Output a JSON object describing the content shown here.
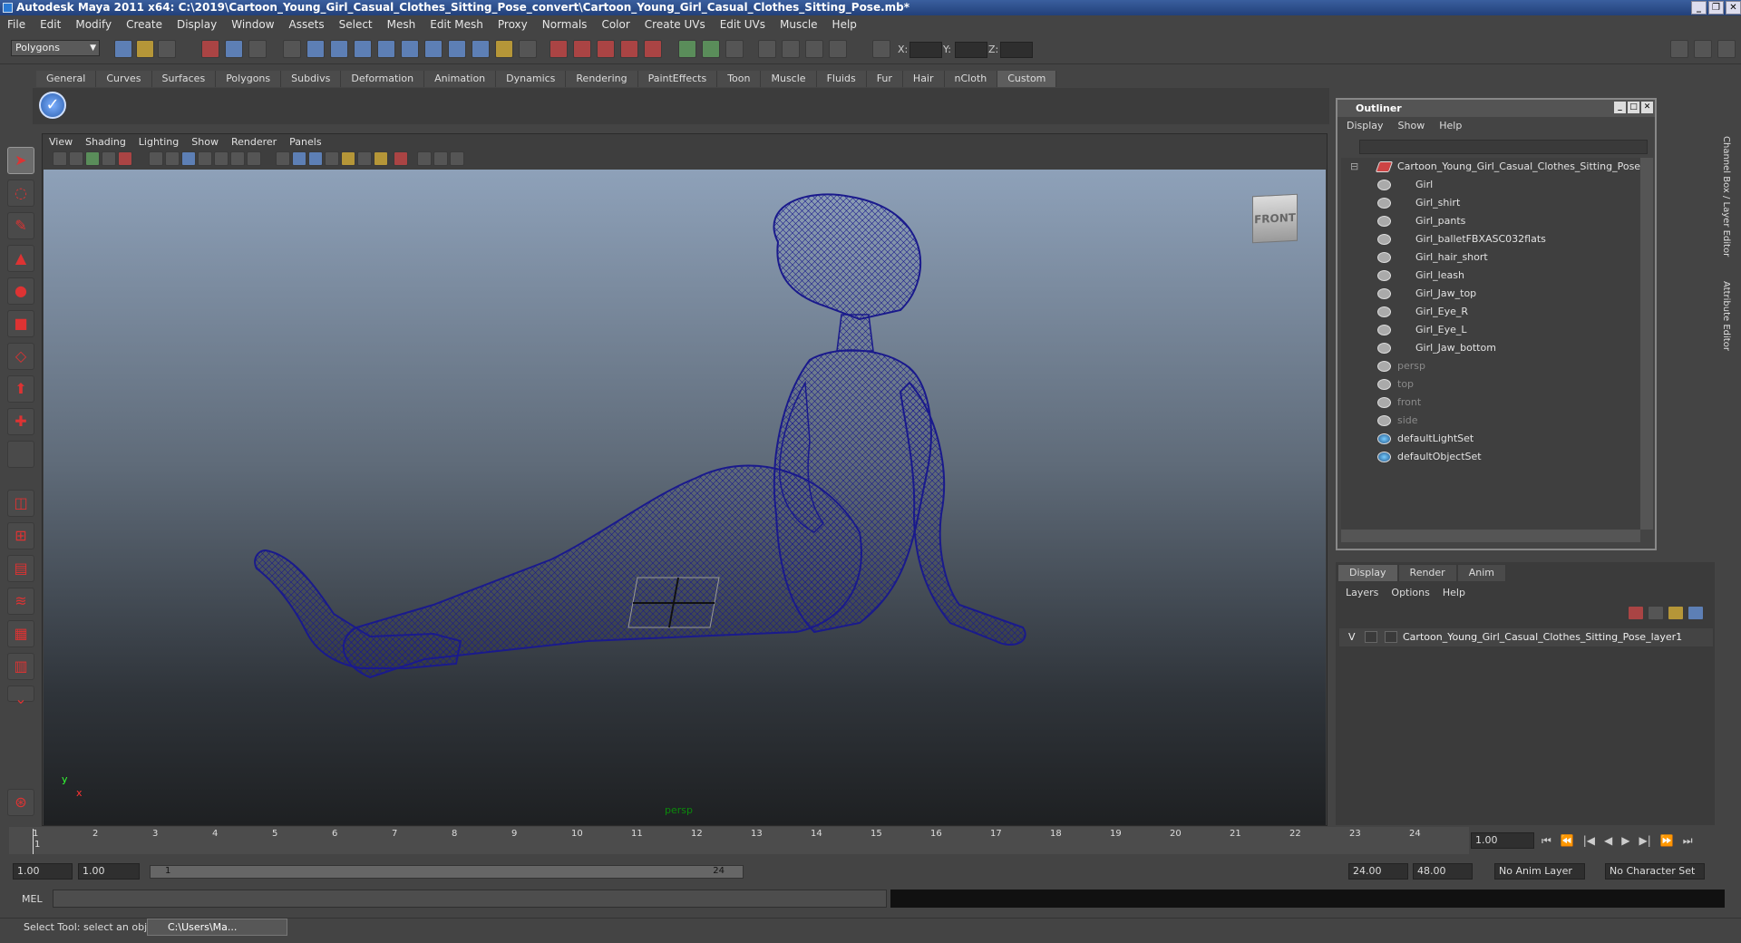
{
  "window": {
    "title": "Autodesk Maya 2011 x64: C:\\2019\\Cartoon_Young_Girl_Casual_Clothes_Sitting_Pose_convert\\Cartoon_Young_Girl_Casual_Clothes_Sitting_Pose.mb*",
    "controls": [
      "_",
      "❐",
      "✕"
    ]
  },
  "menubar": [
    "File",
    "Edit",
    "Modify",
    "Create",
    "Display",
    "Window",
    "Assets",
    "Select",
    "Mesh",
    "Edit Mesh",
    "Proxy",
    "Normals",
    "Color",
    "Create UVs",
    "Edit UVs",
    "Muscle",
    "Help"
  ],
  "status": {
    "mode": "Polygons",
    "x_label": "X:",
    "y_label": "Y:",
    "z_label": "Z:"
  },
  "shelf_tabs": [
    "General",
    "Curves",
    "Surfaces",
    "Polygons",
    "Subdivs",
    "Deformation",
    "Animation",
    "Dynamics",
    "Rendering",
    "PaintEffects",
    "Toon",
    "Muscle",
    "Fluids",
    "Fur",
    "Hair",
    "nCloth",
    "Custom"
  ],
  "shelf_active": "Custom",
  "viewport": {
    "menu": [
      "View",
      "Shading",
      "Lighting",
      "Show",
      "Renderer",
      "Panels"
    ],
    "viewcube": "FRONT",
    "camera": "persp",
    "axis_y": "y",
    "axis_x": "x",
    "wire_color": "#1a1a8c"
  },
  "outliner": {
    "title": "Outliner",
    "menu": [
      "Display",
      "Show",
      "Help"
    ],
    "items": [
      {
        "label": "Cartoon_Young_Girl_Casual_Clothes_Sitting_Pose",
        "kind": "group"
      },
      {
        "label": "Girl",
        "kind": "mesh"
      },
      {
        "label": "Girl_shirt",
        "kind": "mesh"
      },
      {
        "label": "Girl_pants",
        "kind": "mesh"
      },
      {
        "label": "Girl_balletFBXASC032flats",
        "kind": "mesh"
      },
      {
        "label": "Girl_hair_short",
        "kind": "mesh"
      },
      {
        "label": "Girl_leash",
        "kind": "mesh"
      },
      {
        "label": "Girl_Jaw_top",
        "kind": "mesh"
      },
      {
        "label": "Girl_Eye_R",
        "kind": "mesh"
      },
      {
        "label": "Girl_Eye_L",
        "kind": "mesh"
      },
      {
        "label": "Girl_Jaw_bottom",
        "kind": "mesh"
      },
      {
        "label": "persp",
        "kind": "camera"
      },
      {
        "label": "top",
        "kind": "camera"
      },
      {
        "label": "front",
        "kind": "camera"
      },
      {
        "label": "side",
        "kind": "camera"
      },
      {
        "label": "defaultLightSet",
        "kind": "set"
      },
      {
        "label": "defaultObjectSet",
        "kind": "set"
      }
    ]
  },
  "layer_editor": {
    "tabs": [
      "Display",
      "Render",
      "Anim"
    ],
    "active_tab": "Display",
    "menu": [
      "Layers",
      "Options",
      "Help"
    ],
    "layer": {
      "visible": "V",
      "name": "Cartoon_Young_Girl_Casual_Clothes_Sitting_Pose_layer1"
    }
  },
  "side_tabs": [
    "Channel Box / Layer Editor",
    "Attribute Editor"
  ],
  "timeline": {
    "frames": [
      "1",
      "2",
      "3",
      "4",
      "5",
      "6",
      "7",
      "8",
      "9",
      "10",
      "11",
      "12",
      "13",
      "14",
      "15",
      "16",
      "17",
      "18",
      "19",
      "20",
      "21",
      "22",
      "23",
      "24"
    ],
    "current_marker": "1",
    "current_frame": "1.00",
    "play_buttons": [
      "⏮",
      "⏪",
      "|◀",
      "◀",
      "▶",
      "▶|",
      "⏩",
      "⏭"
    ]
  },
  "range": {
    "start": "1.00",
    "playback_start": "1.00",
    "slider_start": "1",
    "slider_end": "24",
    "playback_end": "24.00",
    "end": "48.00",
    "anim_layer": "No Anim Layer",
    "character_set": "No Character Set"
  },
  "command": {
    "label": "MEL"
  },
  "help": {
    "text": "Select Tool: select an object",
    "task": "C:\\Users\\Ma..."
  }
}
